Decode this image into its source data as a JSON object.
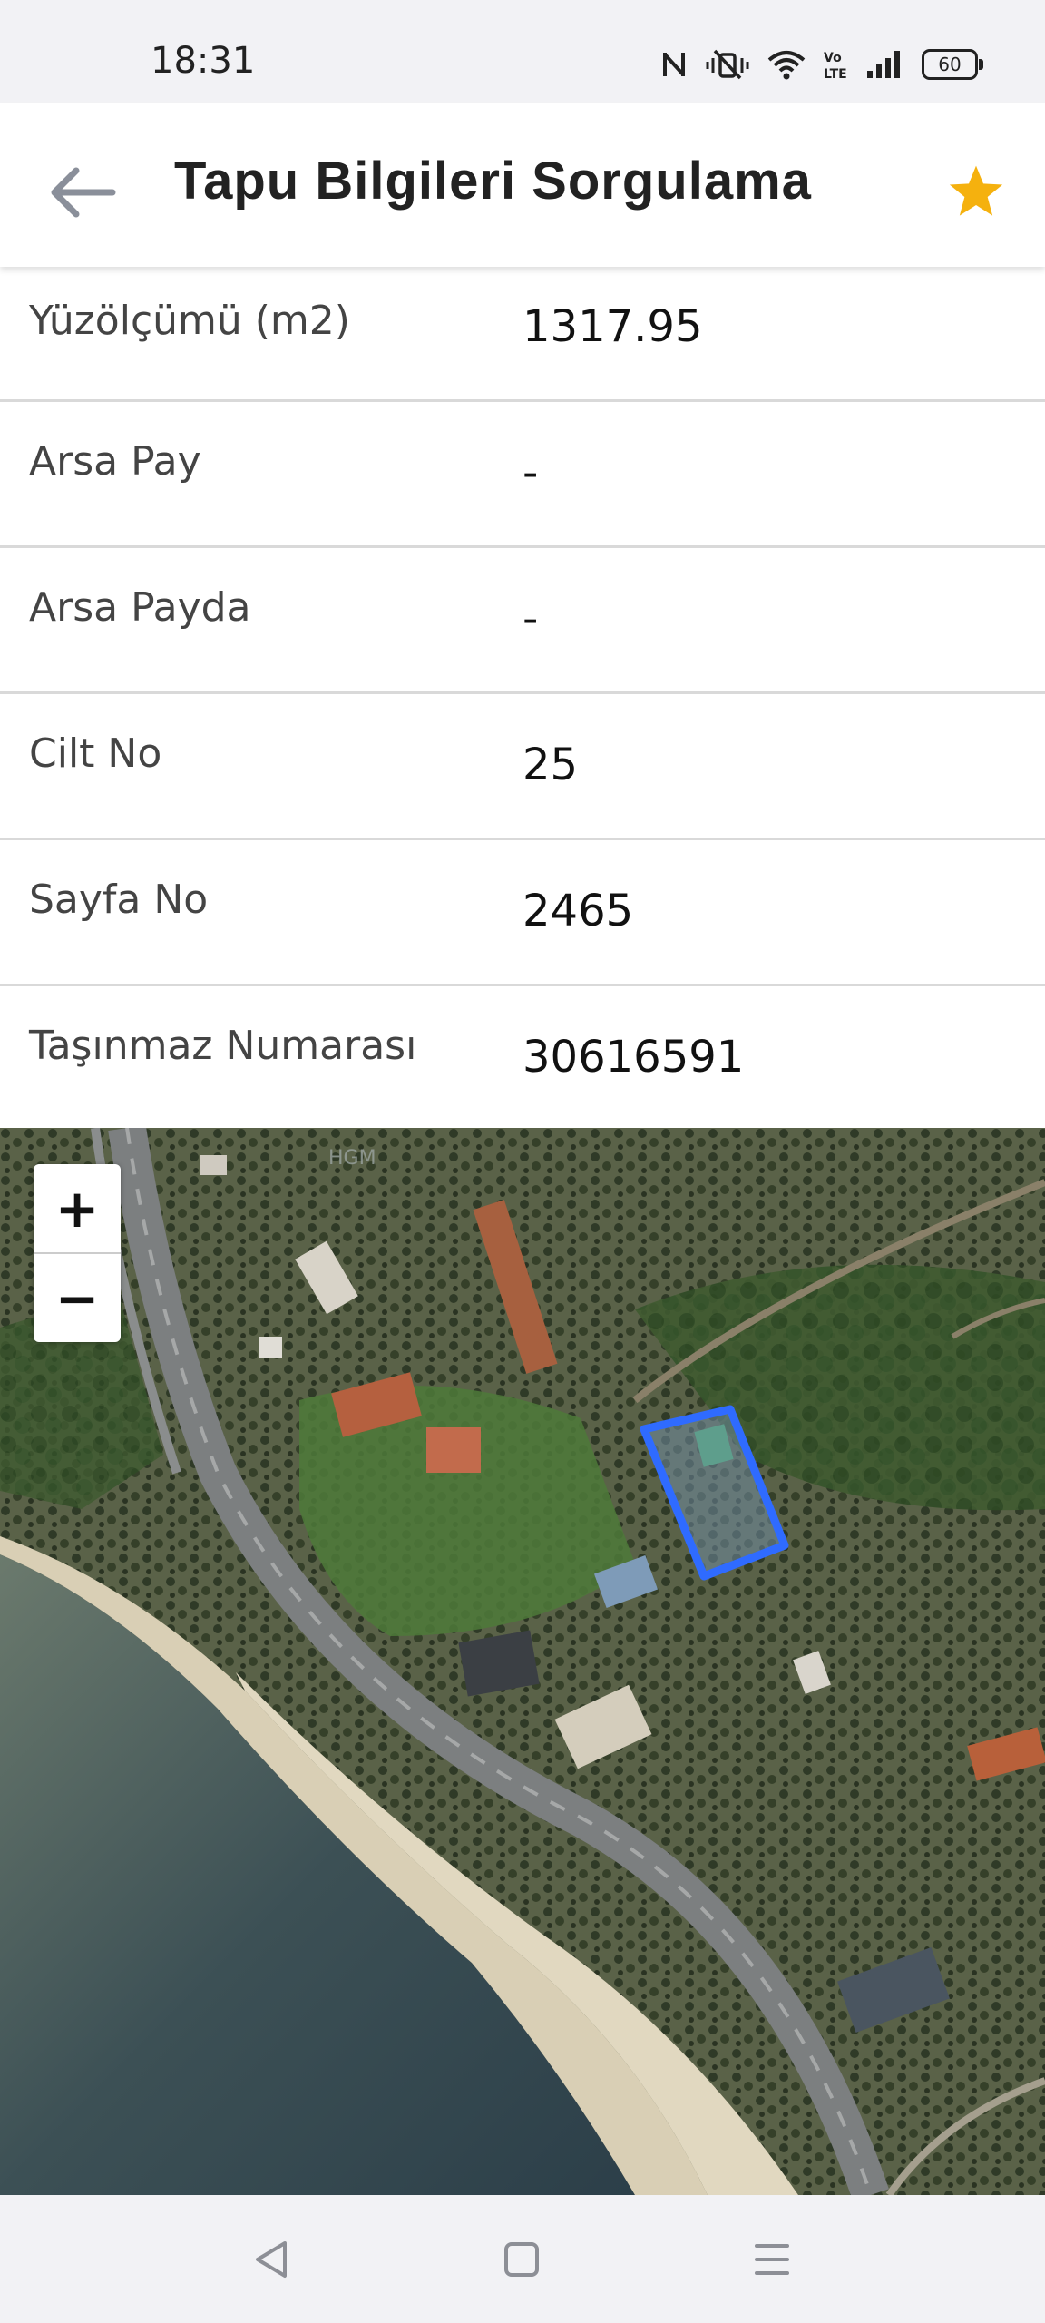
{
  "status_bar": {
    "time": "18:31",
    "battery_level": "60",
    "icons": [
      "nfc-icon",
      "vibrate-mute-icon",
      "wifi-icon",
      "volte-icon",
      "signal-icon",
      "battery-icon"
    ]
  },
  "app_bar": {
    "title": "Tapu Bilgileri Sorgulama",
    "back_icon": "arrow-left-icon",
    "favorite_icon": "star-icon",
    "favorite_color": "#f5b10e"
  },
  "info_rows": [
    {
      "label": "Yüzölçümü (m2)",
      "value": "1317.95"
    },
    {
      "label": "Arsa Pay",
      "value": "-"
    },
    {
      "label": "Arsa Payda",
      "value": "-"
    },
    {
      "label": "Cilt No",
      "value": "25"
    },
    {
      "label": "Sayfa No",
      "value": "2465"
    },
    {
      "label": "Taşınmaz Numarası",
      "value": "30616591"
    }
  ],
  "map": {
    "type": "satellite",
    "zoom_in_label": "+",
    "zoom_out_label": "−",
    "watermark": "HGM",
    "parcel_outline_color": "#2f6bff"
  },
  "nav_bar": {
    "buttons": [
      "back-triangle-icon",
      "home-square-icon",
      "menu-lines-icon"
    ]
  }
}
